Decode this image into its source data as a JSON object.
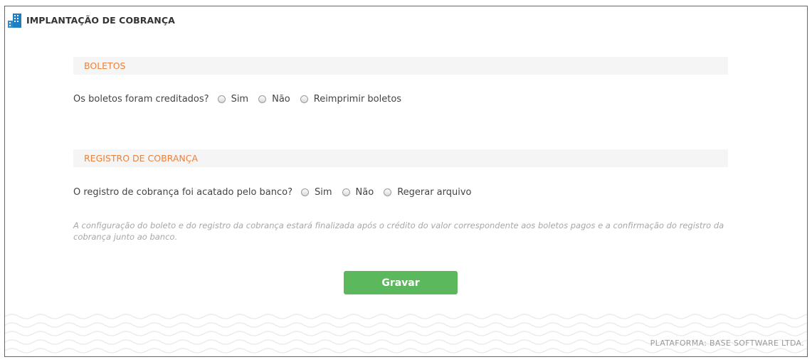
{
  "header": {
    "title": "IMPLANTAÇÃO DE COBRANÇA",
    "icon": "building-icon"
  },
  "boletos": {
    "section_title": "BOLETOS",
    "question": "Os boletos foram creditados?",
    "options": [
      "Sim",
      "Não",
      "Reimprimir boletos"
    ]
  },
  "registro": {
    "section_title": "REGISTRO DE COBRANÇA",
    "question": "O registro de cobrança foi acatado pelo banco?",
    "options": [
      "Sim",
      "Não",
      "Regerar arquivo"
    ]
  },
  "note": "A configuração do boleto e do registro da cobrança estará finalizada após o crédito do valor correspondente aos boletos pagos e a confirmação do registro da cobrança junto ao banco.",
  "actions": {
    "save_label": "Gravar"
  },
  "footer": {
    "platform": "PLATAFORMA: BASE SOFTWARE LTDA."
  },
  "colors": {
    "accent": "#e8823f",
    "button": "#5cb85c",
    "icon": "#2a8fd1"
  }
}
